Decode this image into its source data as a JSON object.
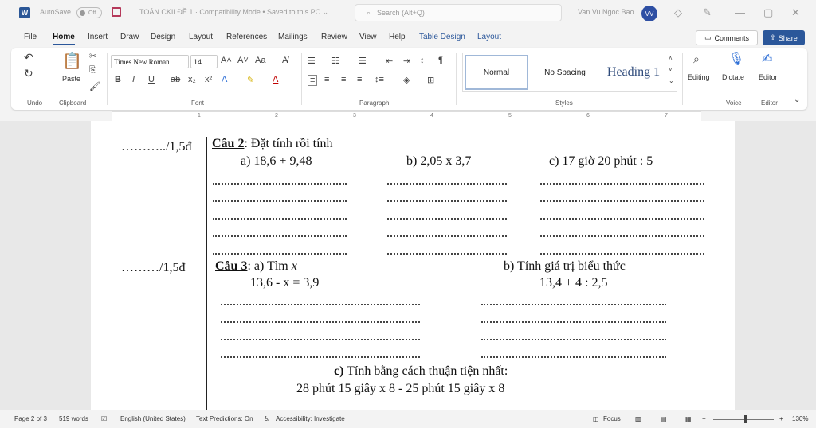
{
  "titlebar": {
    "app_logo": "W",
    "autosave_label": "AutoSave",
    "autosave_state": "Off",
    "document_title": "TOÁN CKII ĐỀ 1  ·  Compatibility Mode • Saved to this PC ⌄",
    "search_placeholder": "Search (Alt+Q)",
    "user_name": "Van Vu Ngoc Bao",
    "user_initials": "VV"
  },
  "menu": {
    "tabs": [
      "File",
      "Home",
      "Insert",
      "Draw",
      "Design",
      "Layout",
      "References",
      "Mailings",
      "Review",
      "View",
      "Help",
      "Table Design",
      "Layout"
    ],
    "active": "Home",
    "comments_label": "Comments",
    "share_label": "Share"
  },
  "ribbon": {
    "groups": [
      "Undo",
      "Clipboard",
      "Font",
      "Paragraph",
      "Styles",
      "Voice",
      "Editor"
    ],
    "paste_label": "Paste",
    "font_name": "Times New Roman",
    "font_size": "14",
    "styles": [
      "Normal",
      "No Spacing",
      "Heading 1"
    ],
    "editing_label": "Editing",
    "dictate_label": "Dictate",
    "editor_label": "Editor"
  },
  "ruler": {
    "numbers": [
      "1",
      "2",
      "3",
      "4",
      "5",
      "6",
      "7"
    ]
  },
  "document": {
    "q2": {
      "score": "………../1,5đ",
      "title": "Câu 2",
      "instruction": ":  Đặt tính rồi tính",
      "a": "a) 18,6 +  9,48",
      "b": "b)  2,05  x  3,7",
      "c": "c) 17 giờ 20 phút : 5"
    },
    "q3": {
      "score": "………/1,5đ",
      "title": "Câu 3",
      "part_a_label": ":   a)  Tìm ",
      "part_a_var": "x",
      "part_a_expr": "13,6  -  x  =  3,9",
      "part_b_label": "b)  Tính giá trị biểu thức",
      "part_b_expr": "13,4  +  4  :  2,5",
      "part_c_label": "c)",
      "part_c_text": " Tính bằng cách thuận tiện nhất:",
      "part_c_expr": "28 phút 15 giây   x  8  -  25 phút 15 giây  x  8"
    }
  },
  "status": {
    "page": "Page 2 of 3",
    "words": "519 words",
    "language": "English (United States)",
    "predictions": "Text Predictions: On",
    "accessibility": "Accessibility: Investigate",
    "focus": "Focus",
    "zoom": "130%"
  }
}
